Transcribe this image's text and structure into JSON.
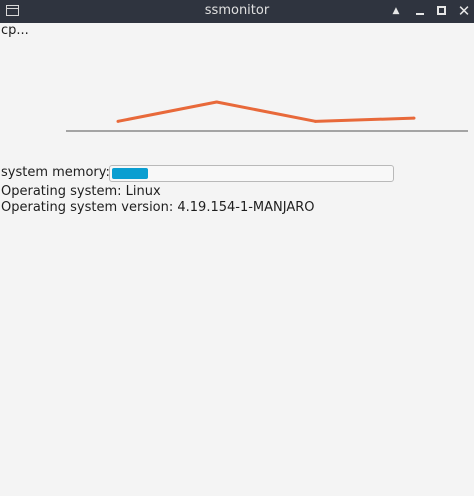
{
  "window": {
    "title": "ssmonitor",
    "buttons": {
      "menu": "window-menu-icon",
      "shade": "▲",
      "minimize": "minimize-icon",
      "maximize": "maximize-icon",
      "close": "✕"
    }
  },
  "cpu": {
    "label": "cp..."
  },
  "chart_data": {
    "type": "line",
    "x": [
      1,
      2,
      3,
      4
    ],
    "series": [
      {
        "values": [
          0.3,
          0.9,
          0.3,
          0.4
        ],
        "color": "#e8693a"
      }
    ],
    "ylim": [
      0,
      2.7
    ],
    "axis_color": "#555555",
    "grid": false
  },
  "memory": {
    "label": "system memory:",
    "progress": 0.08,
    "bar_color": "#0a9ed1"
  },
  "os": {
    "name": "Operating system: Linux",
    "version": "Operating system version: 4.19.154-1-MANJARO"
  }
}
